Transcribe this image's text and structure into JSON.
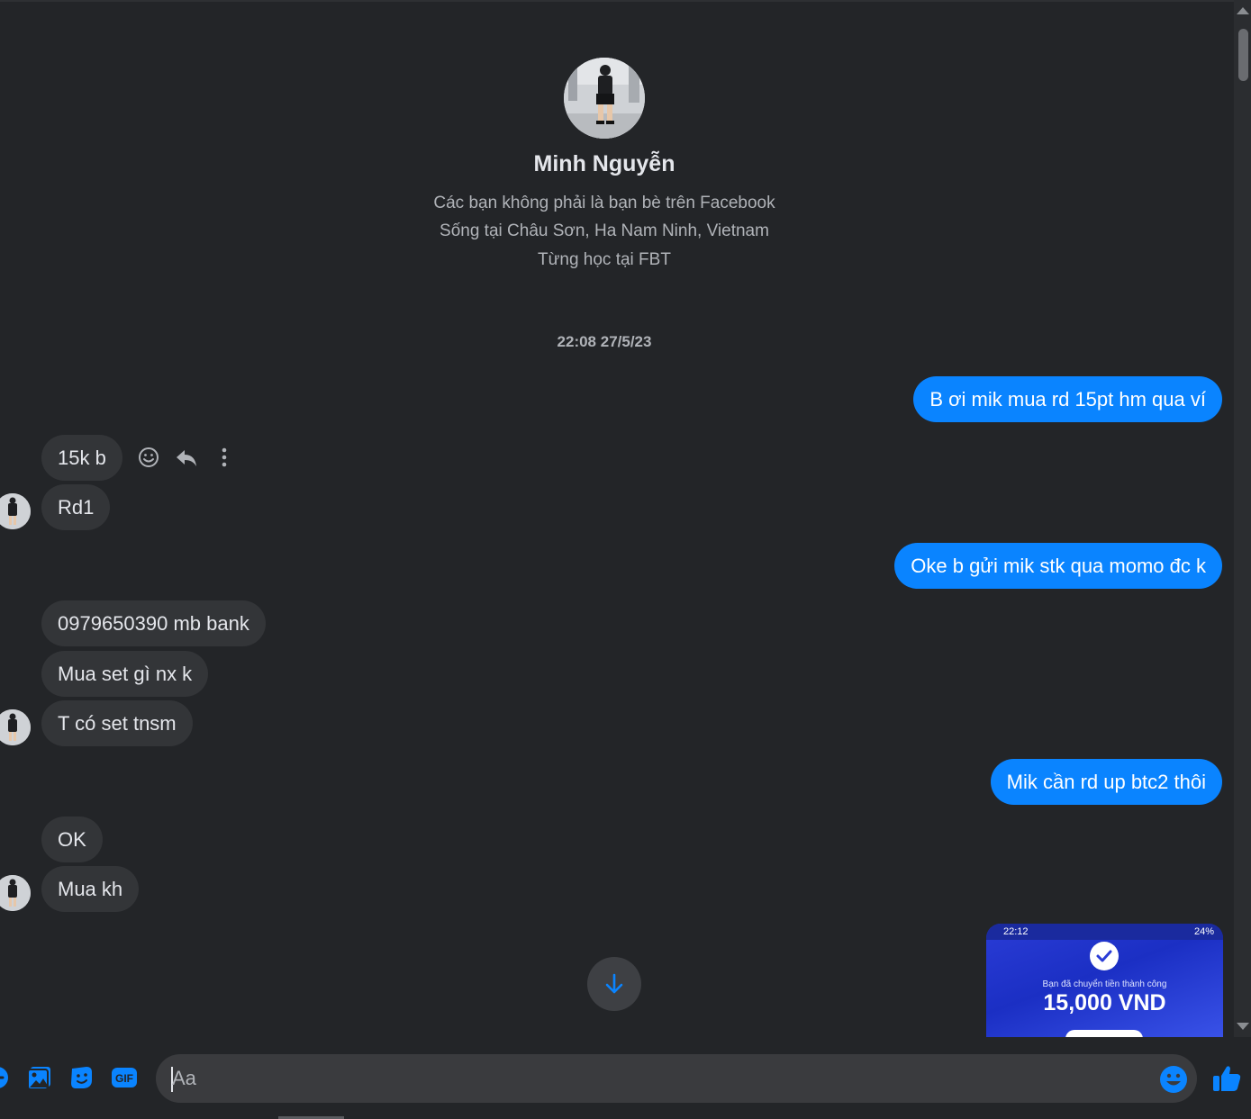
{
  "profile": {
    "name": "Minh Nguyễn",
    "info_lines": [
      "Các bạn không phải là bạn bè trên Facebook",
      "Sống tại Châu Sơn, Ha Nam Ninh, Vietnam",
      "Từng học tại FBT"
    ]
  },
  "timestamp": "22:08 27/5/23",
  "messages": [
    {
      "direction": "out",
      "text": "B ơi mik mua rd 15pt hm qua ví"
    },
    {
      "direction": "in",
      "text": "15k b"
    },
    {
      "direction": "in",
      "text": "Rd1"
    },
    {
      "direction": "out",
      "text": "Oke b gửi mik stk qua momo đc k"
    },
    {
      "direction": "in",
      "text": "0979650390 mb bank"
    },
    {
      "direction": "in",
      "text": "Mua set gì nx k"
    },
    {
      "direction": "in",
      "text": "T có set tnsm"
    },
    {
      "direction": "out",
      "text": "Mik cần rd up btc2 thôi"
    },
    {
      "direction": "in",
      "text": "OK"
    },
    {
      "direction": "in",
      "text": "Mua kh"
    }
  ],
  "image_message": {
    "status_time": "22:12",
    "status_right": "24%",
    "caption": "Bạn đã chuyển tiền thành công",
    "amount": "15,000 VND"
  },
  "message_actions": [
    "react-icon",
    "reply-icon",
    "more-icon"
  ],
  "composer": {
    "placeholder": "Aa",
    "tools": [
      "more-actions-icon",
      "attach-image-icon",
      "sticker-icon",
      "gif-icon"
    ]
  },
  "colors": {
    "background": "#232528",
    "incoming_bubble": "#333538",
    "outgoing_bubble": "#0a84ff",
    "accent": "#0a84ff"
  }
}
